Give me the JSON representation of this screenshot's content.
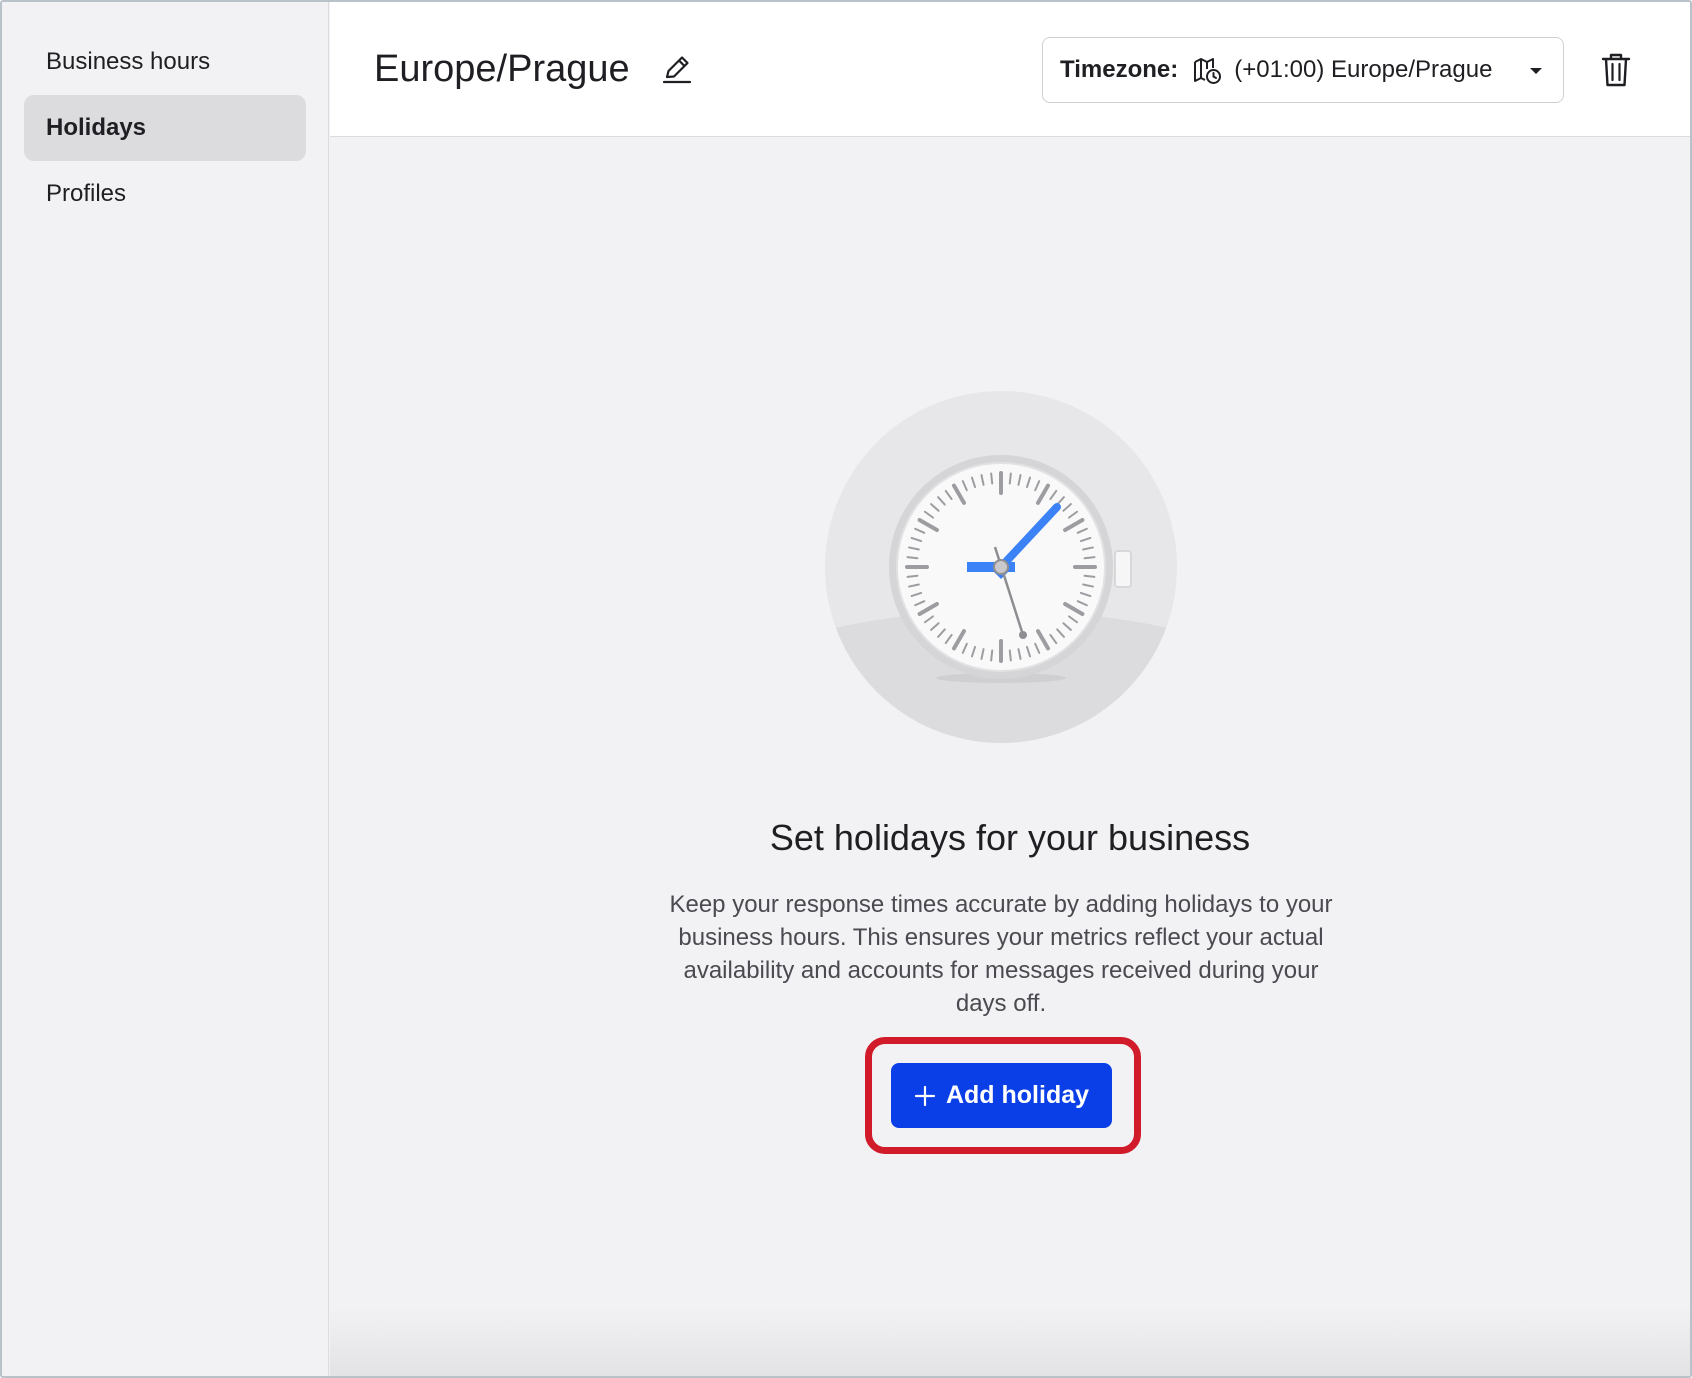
{
  "sidebar": {
    "items": [
      {
        "label": "Business hours",
        "active": false
      },
      {
        "label": "Holidays",
        "active": true
      },
      {
        "label": "Profiles",
        "active": false
      }
    ]
  },
  "header": {
    "title": "Europe/Prague",
    "edit_icon": "pencil-icon",
    "timezone": {
      "label": "Timezone:",
      "icon": "map-clock-icon",
      "value": "(+01:00) Europe/Prague",
      "caret_icon": "caret-down-icon"
    },
    "delete_icon": "trash-icon"
  },
  "empty_state": {
    "illustration": "clock-illustration",
    "title": "Set holidays for your business",
    "description": "Keep your response times accurate by adding holidays to your business hours. This ensures your metrics reflect your actual availability and accounts for messages received during your days off.",
    "button": {
      "label": "Add holiday",
      "icon": "plus-icon"
    }
  },
  "colors": {
    "primary": "#0a3fe8",
    "highlight": "#d11a2a",
    "clock_hand": "#3b82f6",
    "background": "#f2f2f4"
  }
}
